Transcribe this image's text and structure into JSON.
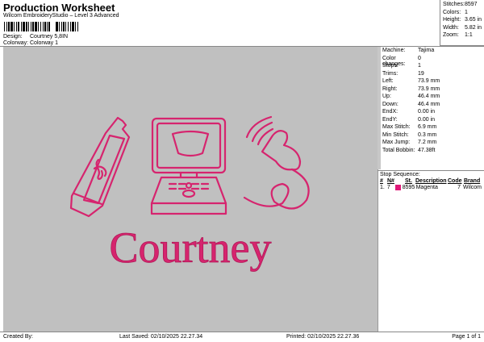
{
  "header": {
    "title": "Production Worksheet",
    "subtitle": "Wilcom EmbroideryStudio – Level 3 Advanced",
    "design_label": "Design:",
    "design": "Courtney 5,8IN",
    "colorway_label": "Colorway:",
    "colorway": "Colorway 1"
  },
  "stats": [
    {
      "k": "Stitches:",
      "v": "8597"
    },
    {
      "k": "Colors:",
      "v": "1"
    },
    {
      "k": "Height:",
      "v": "3.65 in"
    },
    {
      "k": "Width:",
      "v": "5.82 in"
    },
    {
      "k": "Zoom:",
      "v": "1:1"
    }
  ],
  "props": [
    {
      "k": "Machine:",
      "v": "Tajima"
    },
    {
      "k": "Color changes:",
      "v": "0"
    },
    {
      "k": "Stops:",
      "v": "1"
    },
    {
      "k": "Trims:",
      "v": "19"
    },
    {
      "k": "Left:",
      "v": "73.9 mm"
    },
    {
      "k": "Right:",
      "v": "73.9 mm"
    },
    {
      "k": "Up:",
      "v": "46.4 mm"
    },
    {
      "k": "Down:",
      "v": "46.4 mm"
    },
    {
      "k": "EndX:",
      "v": "0.00 in"
    },
    {
      "k": "EndY:",
      "v": "0.00 in"
    },
    {
      "k": "Max Stitch:",
      "v": "6.9 mm"
    },
    {
      "k": "Min Stitch:",
      "v": "0.3 mm"
    },
    {
      "k": "Max Jump:",
      "v": "7.2 mm"
    },
    {
      "k": "Total Bobbin:",
      "v": "47.38ft"
    }
  ],
  "stop_sequence": {
    "title": "Stop Sequence:",
    "headers": [
      "#",
      "N#",
      "St.",
      "Description",
      "Code",
      "Brand"
    ],
    "rows": [
      {
        "num": "1.",
        "n": "7",
        "st": "8595",
        "desc": "Magenta",
        "code": "7",
        "brand": "Wilcom",
        "color": "#e0197a"
      }
    ]
  },
  "design": {
    "name_text": "Courtney",
    "thread_color": "#d6246e",
    "background": "#c0c0c0"
  },
  "footer": {
    "created": "Created By:",
    "saved": "Last Saved: 02/10/2025 22.27.34",
    "printed": "Printed: 02/10/2025 22.27.36",
    "page": "Page 1 of 1"
  }
}
